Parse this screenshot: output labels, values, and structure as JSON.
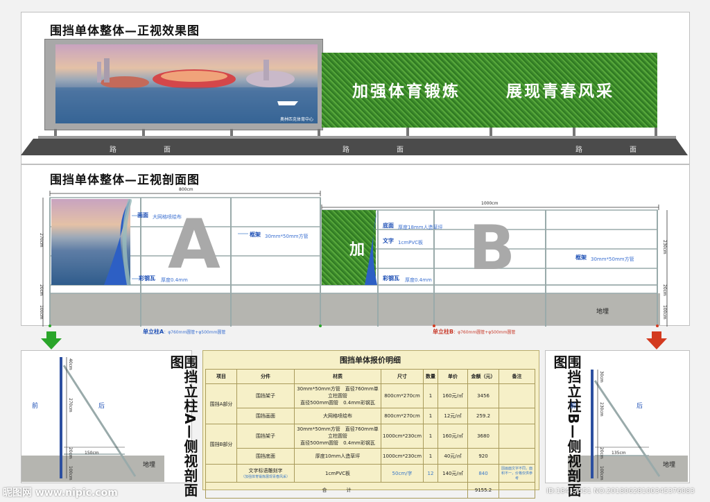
{
  "front": {
    "title": "围挡单体整体—正视效果图",
    "banner_caption": "奥林匹克体育中心",
    "slogan1": "加强体育锻炼",
    "slogan2": "展现青春风采",
    "road_labels": [
      "路",
      "面",
      "路",
      "面",
      "路",
      "面"
    ]
  },
  "section": {
    "title": "围挡单体整体—正视剖面图",
    "dim_a": "800cm",
    "dim_b": "1000cm",
    "height_a": "270cm",
    "height_b": "230cm",
    "base_20": "20cm",
    "base_100": "100cm",
    "letter_a": "A",
    "letter_b": "B",
    "letter_jia": "加",
    "a_labels": [
      {
        "name": "画面",
        "desc": "大网格喷绘布"
      },
      {
        "name": "框架",
        "desc": "30mm*50mm方管"
      },
      {
        "name": "彩钢瓦",
        "desc": "厚度0.4mm"
      }
    ],
    "b_labels": [
      {
        "name": "底面",
        "desc": "厚度18mm人造草坪"
      },
      {
        "name": "文字",
        "desc": "1cmPVC板"
      },
      {
        "name": "彩钢瓦",
        "desc": "厚度0.4mm"
      },
      {
        "name": "框架",
        "desc": "30mm*50mm方管"
      }
    ],
    "post_a_name": "单立柱A",
    "post_a_desc": "：φ760mm圆管+φ500mm圆管",
    "post_b_name": "单立柱B",
    "post_b_desc": "：φ760mm圆管+φ500mm圆管",
    "ground": "地埋",
    "colors": {
      "arrow_a": "#2aa52a",
      "arrow_b": "#d33a1f"
    }
  },
  "side_a": {
    "title": "围挡立柱A—侧视剖面图",
    "front": "前",
    "back": "后",
    "dims": [
      "40cm",
      "270cm",
      "20cm",
      "100cm"
    ],
    "base_w": "150cm",
    "ground": "地埋"
  },
  "side_b": {
    "title": "围挡立柱B—侧视剖面图",
    "front": "前",
    "back": "后",
    "dims": [
      "30cm",
      "230cm",
      "20cm",
      "100cm"
    ],
    "base_w": "135cm",
    "ground": "地埋"
  },
  "quote": {
    "title": "围挡单体报价明细",
    "headers": [
      "项目",
      "分件",
      "材质",
      "尺寸",
      "数量",
      "单价",
      "金额（元）",
      "备注"
    ],
    "group_a": "围挡A部分",
    "group_b": "围挡B部分",
    "rows": [
      {
        "part": "围挡架子",
        "mat1": "30mm*50mm方管　直径760mm单立柱圆管",
        "mat2": "直径500mm圆管　0.4mm彩钢瓦",
        "size": "800cm*270cm",
        "qty": "1",
        "price": "160元/㎡",
        "amount": "3456",
        "note": ""
      },
      {
        "part": "围挡画面",
        "mat1": "大网格喷绘布",
        "mat2": "",
        "size": "800cm*270cm",
        "qty": "1",
        "price": "12元/㎡",
        "amount": "259.2",
        "note": ""
      },
      {
        "part": "围挡架子",
        "mat1": "30mm*50mm方管　直径760mm单立柱圆管",
        "mat2": "直径500mm圆管　0.4mm彩钢瓦",
        "size": "1000cm*230cm",
        "qty": "1",
        "price": "160元/㎡",
        "amount": "3680",
        "note": ""
      },
      {
        "part": "围挡底面",
        "mat1": "厚度10mm人造草坪",
        "mat2": "",
        "size": "1000cm*230cm",
        "qty": "1",
        "price": "40元/㎡",
        "amount": "920",
        "note": ""
      },
      {
        "part": "文字标语雕刻字",
        "part2": "（加强体育锻炼展现青春风采）",
        "mat1": "1cmPVC板",
        "mat2": "",
        "size": "50cm/字",
        "qty": "12",
        "price": "140元/㎡",
        "amount": "840",
        "note": "因画面文字不同，面积不一，价格仅供参考"
      }
    ],
    "total_label": "合　　　　计",
    "total": "9155.2"
  },
  "watermark": {
    "left": "昵图网 www.nipic.com",
    "right": "ID:18417551 NO:20180628100345376083"
  }
}
